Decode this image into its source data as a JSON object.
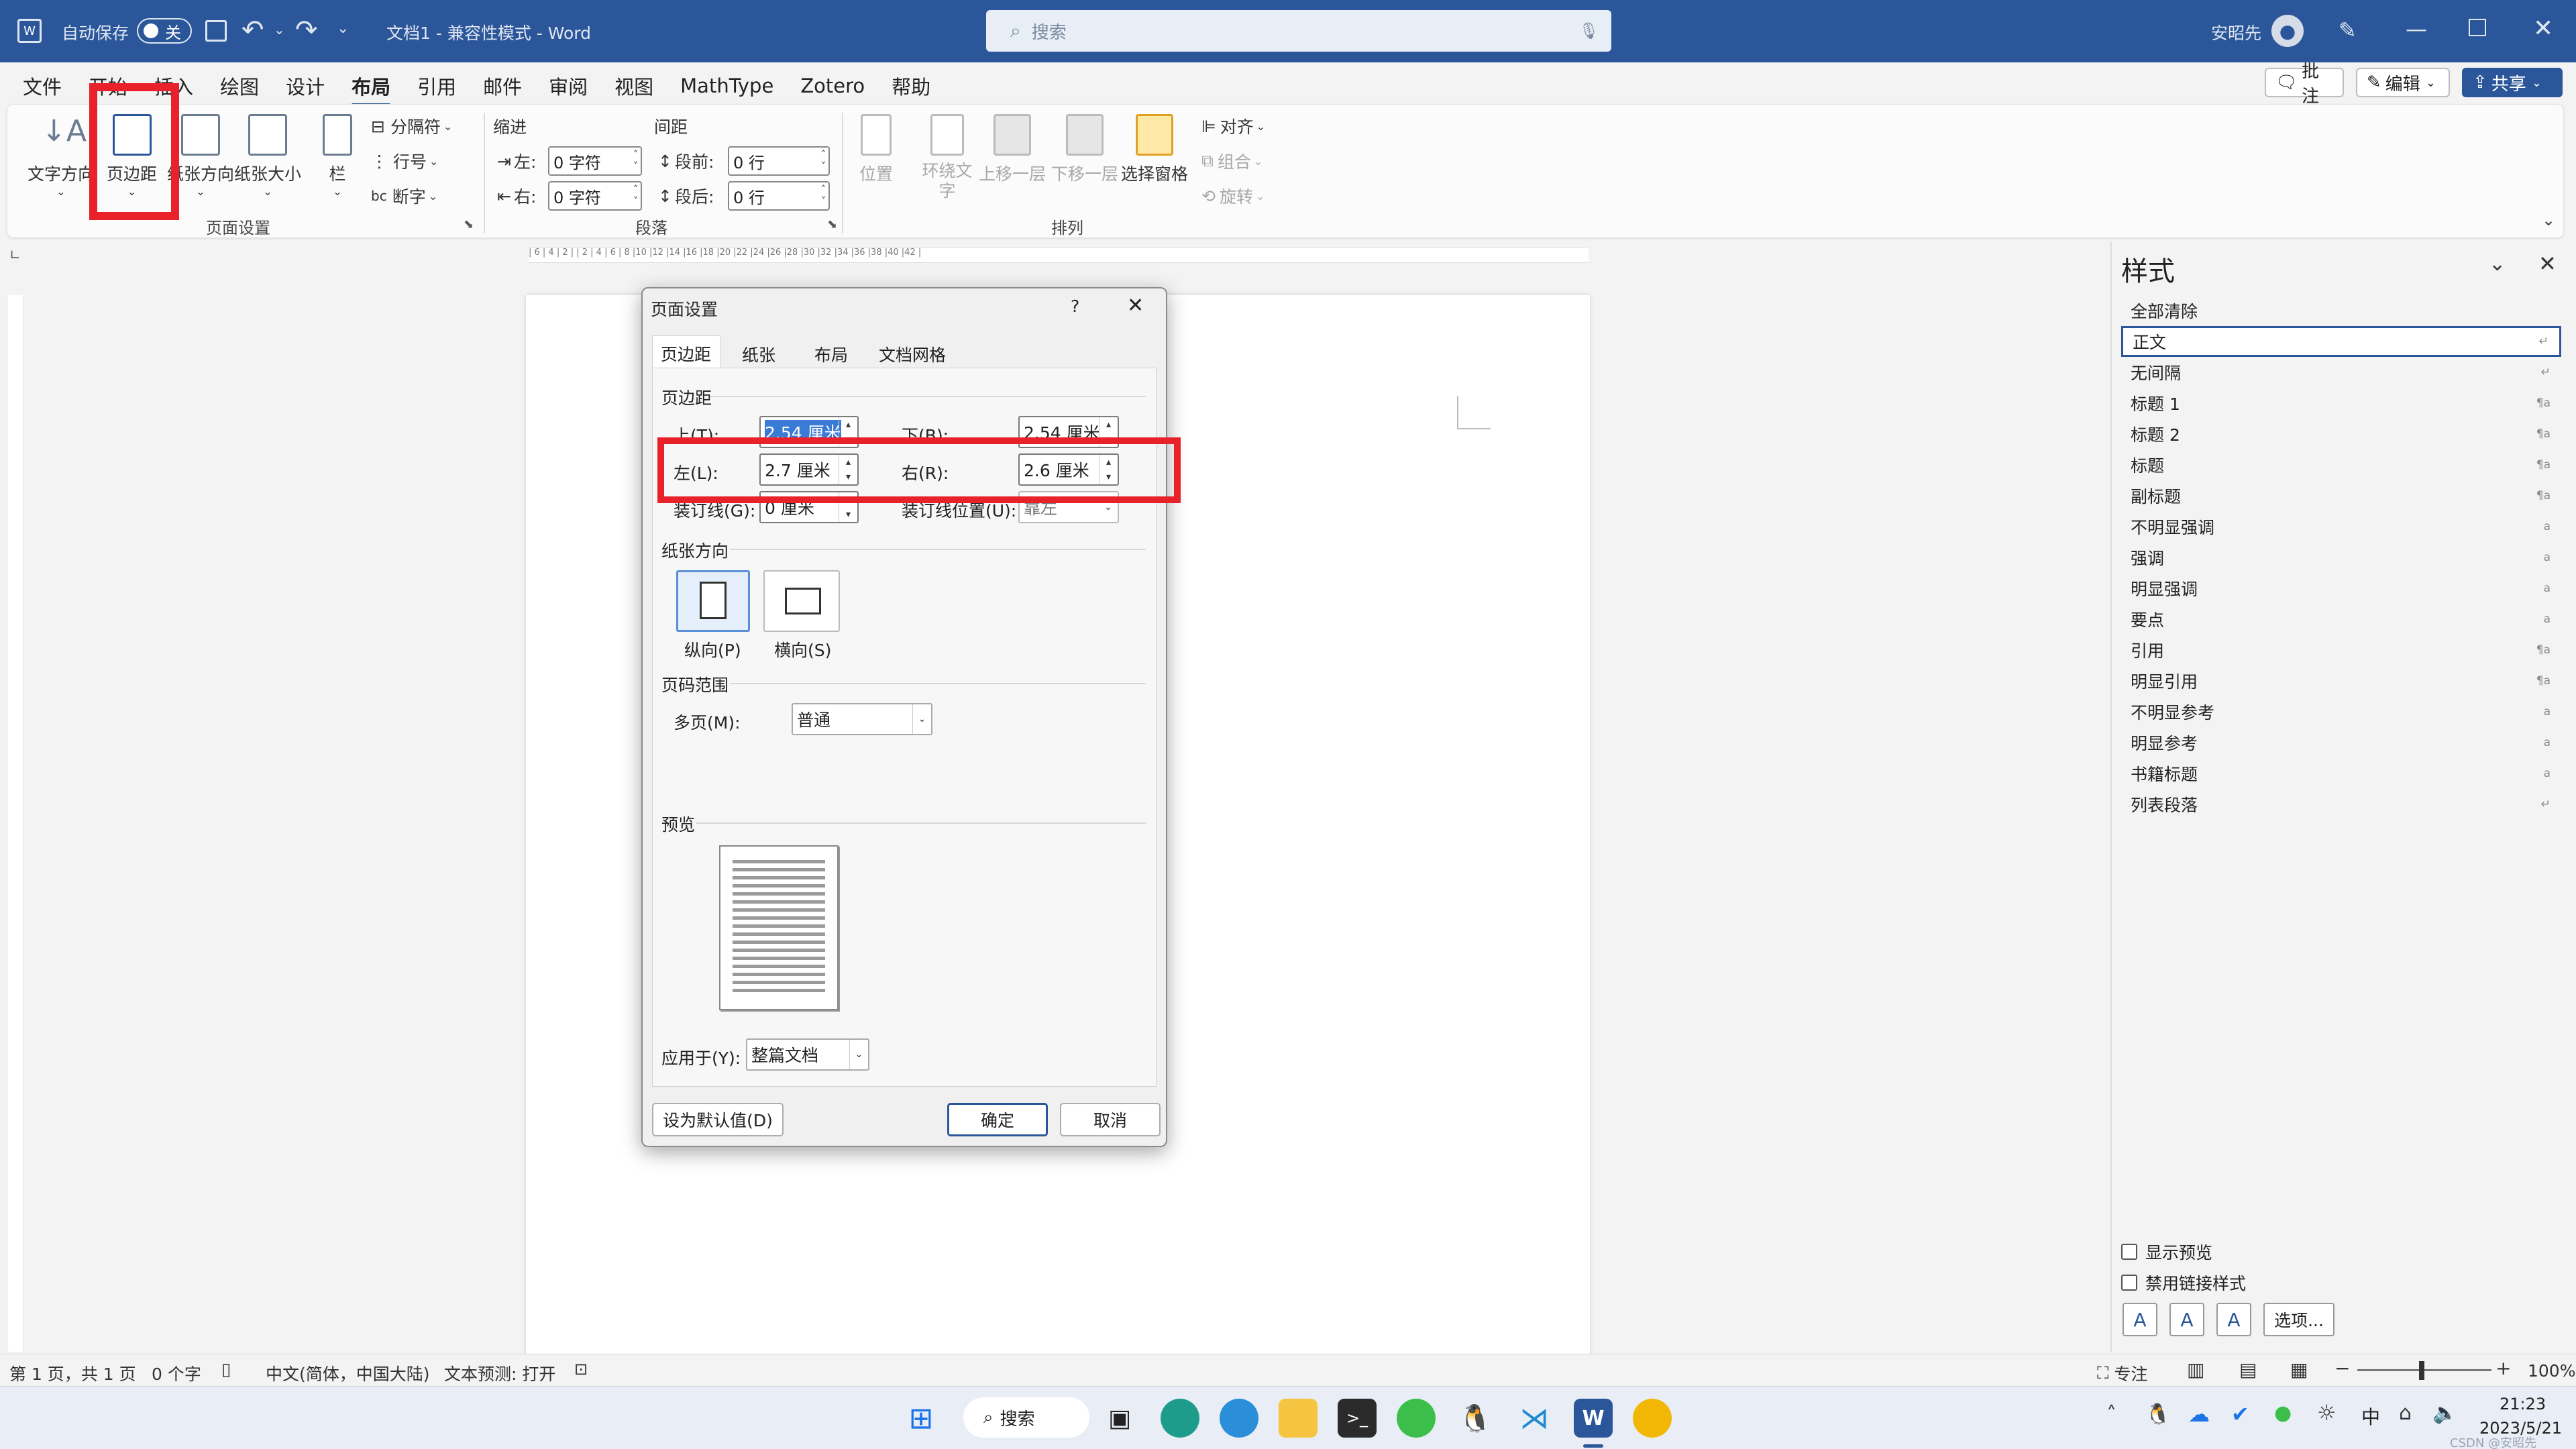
{
  "titlebar": {
    "autosave_label": "自动保存",
    "autosave_state": "关",
    "doc_title": "文档1  -  兼容性模式  -  Word",
    "search_placeholder": "搜索",
    "user_name": "安昭先"
  },
  "menu": {
    "items": [
      "文件",
      "开始",
      "插入",
      "绘图",
      "设计",
      "布局",
      "引用",
      "邮件",
      "审阅",
      "视图",
      "MathType",
      "Zotero",
      "帮助"
    ],
    "active": "布局",
    "comment_btn": "批注",
    "edit_btn": "编辑",
    "share_btn": "共享"
  },
  "ribbon": {
    "text_direction": "文字方向",
    "margins": "页边距",
    "orientation": "纸张方向",
    "size": "纸张大小",
    "columns": "栏",
    "breaks": "分隔符",
    "line_numbers": "行号",
    "hyphenation": "断字",
    "group_page_setup": "页面设置",
    "indent_title": "缩进",
    "spacing_title": "间距",
    "indent_left_label": "左:",
    "indent_left_value": "0 字符",
    "indent_right_label": "右:",
    "indent_right_value": "0 字符",
    "space_before_label": "段前:",
    "space_before_value": "0 行",
    "space_after_label": "段后:",
    "space_after_value": "0 行",
    "group_paragraph": "段落",
    "position": "位置",
    "wrap_text": "环绕文字",
    "bring_forward": "上移一层",
    "send_backward": "下移一层",
    "selection_pane": "选择窗格",
    "align": "对齐",
    "group_btn": "组合",
    "rotate": "旋转",
    "group_arrange": "排列"
  },
  "ruler_text": "| 6 | 4 | 2 |   | 2 | 4 | 6 | 8 |10 |12 |14 |16 |18 |20 |22 |24 |26 |28 |30 |32 |34 |36 |38 |40 |42 |",
  "dialog": {
    "title": "页面设置",
    "help": "?",
    "tabs": [
      "页边距",
      "纸张",
      "布局",
      "文档网格"
    ],
    "margins_section": "页边距",
    "top_label": "上(T):",
    "top_value": "2.54 厘米",
    "bottom_label": "下(B):",
    "bottom_value": "2.54 厘米",
    "left_label": "左(L):",
    "left_value": "2.7 厘米",
    "right_label": "右(R):",
    "right_value": "2.6 厘米",
    "gutter_label": "装订线(G):",
    "gutter_value": "0 厘米",
    "gutter_pos_label": "装订线位置(U):",
    "gutter_pos_value": "靠左",
    "orientation_section": "纸张方向",
    "portrait": "纵向(P)",
    "landscape": "横向(S)",
    "pages_section": "页码范围",
    "multiple_pages_label": "多页(M):",
    "multiple_pages_value": "普通",
    "preview_section": "预览",
    "apply_to_label": "应用于(Y):",
    "apply_to_value": "整篇文档",
    "set_default": "设为默认值(D)",
    "ok": "确定",
    "cancel": "取消"
  },
  "styles_pane": {
    "title": "样式",
    "items": [
      {
        "name": "全部清除",
        "mark": ""
      },
      {
        "name": "正文",
        "mark": "↵"
      },
      {
        "name": "无间隔",
        "mark": "↵"
      },
      {
        "name": "标题 1",
        "mark": "¶a"
      },
      {
        "name": "标题 2",
        "mark": "¶a"
      },
      {
        "name": "标题",
        "mark": "¶a"
      },
      {
        "name": "副标题",
        "mark": "¶a"
      },
      {
        "name": "不明显强调",
        "mark": "a"
      },
      {
        "name": "强调",
        "mark": "a"
      },
      {
        "name": "明显强调",
        "mark": "a"
      },
      {
        "name": "要点",
        "mark": "a"
      },
      {
        "name": "引用",
        "mark": "¶a"
      },
      {
        "name": "明显引用",
        "mark": "¶a"
      },
      {
        "name": "不明显参考",
        "mark": "a"
      },
      {
        "name": "明显参考",
        "mark": "a"
      },
      {
        "name": "书籍标题",
        "mark": "a"
      },
      {
        "name": "列表段落",
        "mark": "↵"
      }
    ],
    "selected_index": 1,
    "show_preview": "显示预览",
    "disable_linked": "禁用链接样式",
    "options_btn": "选项..."
  },
  "statusbar": {
    "page_info": "第 1 页，共 1 页",
    "word_count": "0 个字",
    "language": "中文(简体，中国大陆)",
    "text_prediction": "文本预测: 打开",
    "focus": "专注",
    "zoom": "100%"
  },
  "taskbar": {
    "search_label": "搜索",
    "ime": "中",
    "time": "21:23",
    "date": "2023/5/21",
    "watermark": "CSDN @安昭先"
  },
  "colors": {
    "titlebar": "#2b579a",
    "highlight": "#e8212b",
    "accent": "#2b579a"
  }
}
